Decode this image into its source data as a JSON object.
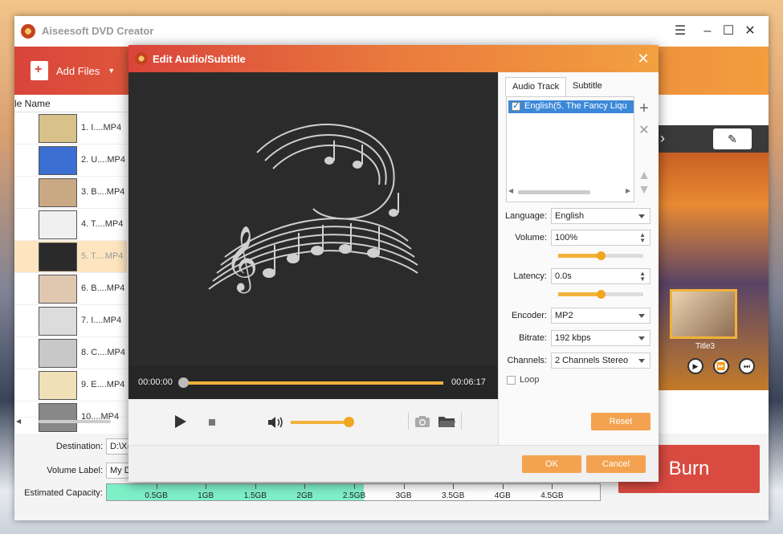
{
  "app": {
    "title": "Aiseesoft DVD Creator",
    "add_files_label": "Add Files",
    "list_header": "le Name",
    "files": [
      {
        "label": "1. I....MP4"
      },
      {
        "label": "2. U....MP4"
      },
      {
        "label": "3. B....MP4"
      },
      {
        "label": "4. T....MP4"
      },
      {
        "label": "5. T....MP4",
        "selected": true
      },
      {
        "label": "6. B....MP4"
      },
      {
        "label": "7. I....MP4"
      },
      {
        "label": "8. C....MP4"
      },
      {
        "label": "9. E....MP4"
      },
      {
        "label": "10....MP4"
      }
    ],
    "destination_label": "Destination:",
    "destination_value": "D:\\X-",
    "volume_label_label": "Volume Label:",
    "volume_label_value": "My D",
    "capacity_label": "Estimated Capacity:",
    "capacity_ticks": [
      "0.5GB",
      "1GB",
      "1.5GB",
      "2GB",
      "2.5GB",
      "3GB",
      "3.5GB",
      "4GB",
      "4.5GB"
    ],
    "capacity_fill_gb": 2.6,
    "preview_title": "Title3",
    "burn_label": "Burn"
  },
  "dialog": {
    "title": "Edit Audio/Subtitle",
    "time_start": "00:00:00",
    "time_end": "00:06:17",
    "seek_progress": 0,
    "volume_level": 0.95,
    "tabs": {
      "audio": "Audio Track",
      "subtitle": "Subtitle"
    },
    "track_item": "English(5. The Fancy Liqu",
    "language_label": "Language:",
    "language_value": "English",
    "volume_label": "Volume:",
    "volume_value": "100%",
    "volume_slider": 0.5,
    "latency_label": "Latency:",
    "latency_value": "0.0s",
    "latency_slider": 0.5,
    "encoder_label": "Encoder:",
    "encoder_value": "MP2",
    "bitrate_label": "Bitrate:",
    "bitrate_value": "192 kbps",
    "channels_label": "Channels:",
    "channels_value": "2 Channels Stereo",
    "loop_label": "Loop",
    "reset_label": "Reset",
    "ok_label": "OK",
    "cancel_label": "Cancel"
  },
  "colors": {
    "accent": "#f3a34f",
    "toolbar_start": "#d9443b",
    "selection": "#3b88d8",
    "burn": "#d94a40"
  }
}
